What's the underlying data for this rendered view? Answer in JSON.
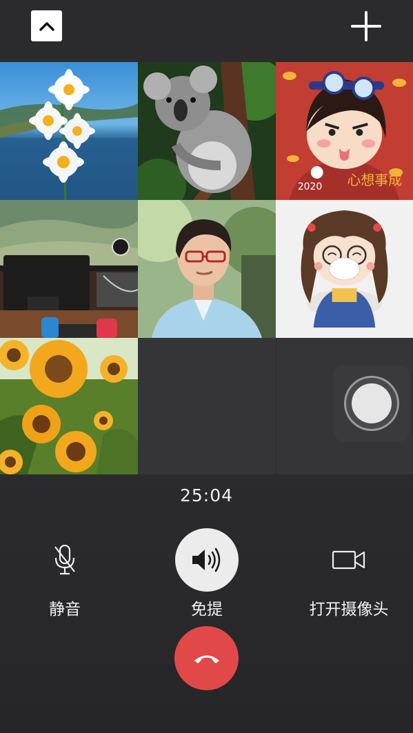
{
  "header": {
    "collapse_icon": "chevron-up-icon",
    "add_icon": "plus-icon"
  },
  "participants": [
    {
      "name": "daisy-avatar"
    },
    {
      "name": "koala-avatar"
    },
    {
      "name": "cartoon-girl-avatar",
      "caption": "2020",
      "slogan": "心想事成"
    },
    {
      "name": "game-screen-avatar"
    },
    {
      "name": "person-selfie-avatar"
    },
    {
      "name": "cartoon-girl-mask-avatar"
    },
    {
      "name": "sunflower-avatar"
    }
  ],
  "call": {
    "timer": "25:04",
    "mute_label": "静音",
    "speaker_label": "免提",
    "camera_label": "打开摄像头"
  },
  "colors": {
    "background": "#2a2a2c",
    "hangup": "#e14848",
    "speaker_bg": "#ececec"
  }
}
